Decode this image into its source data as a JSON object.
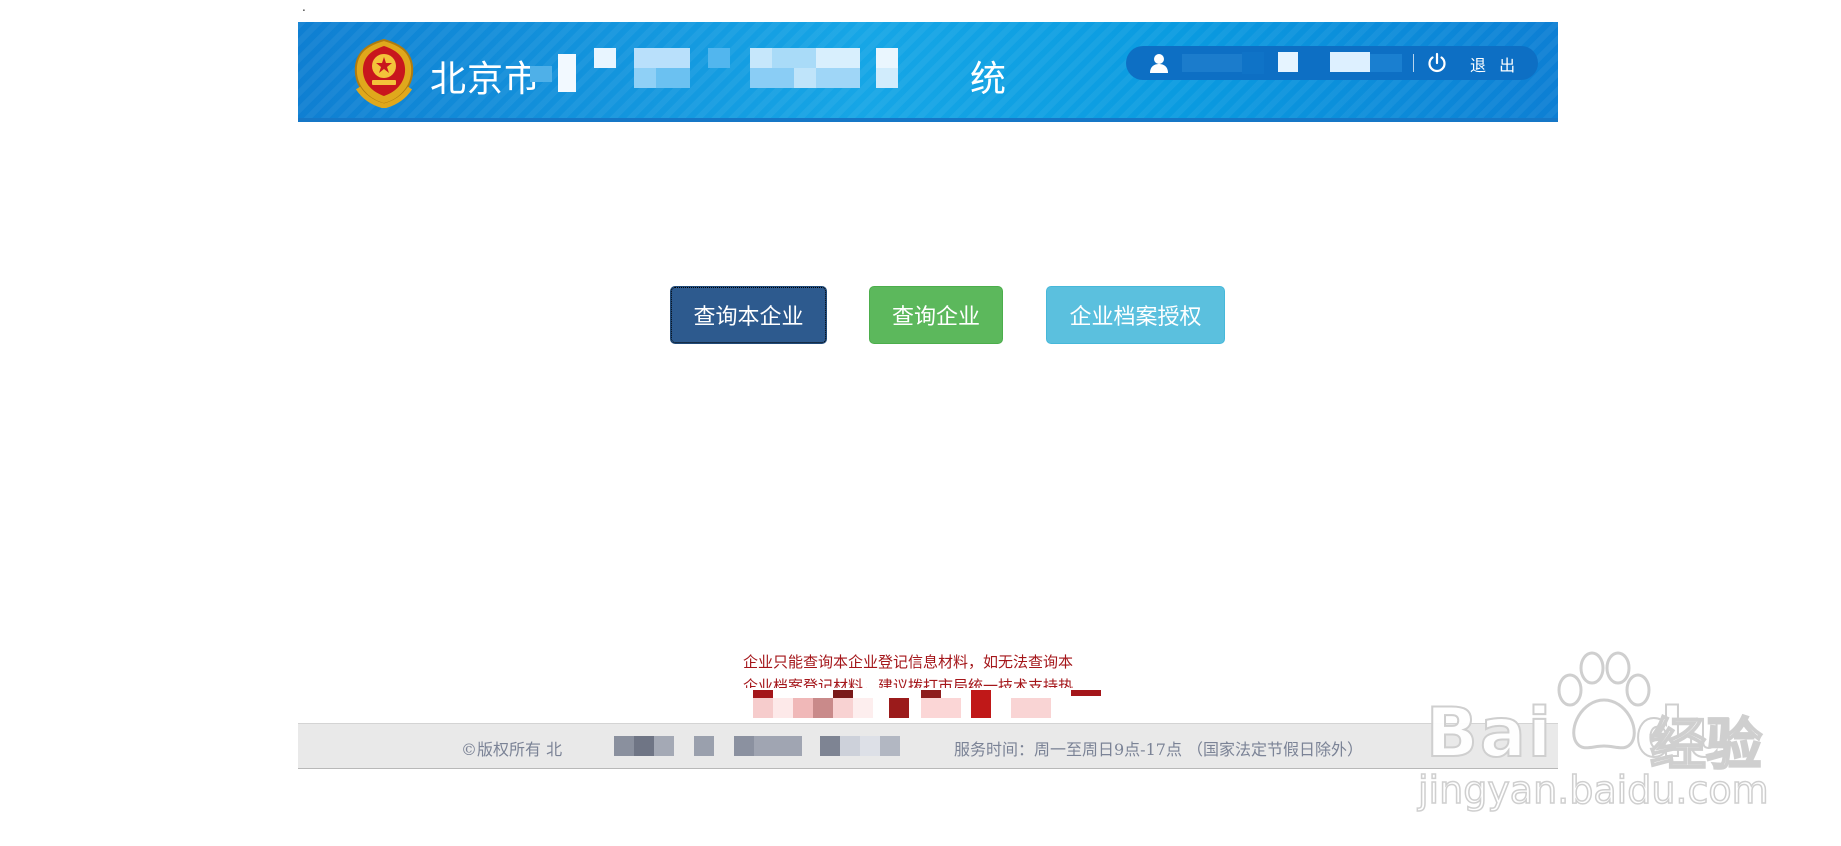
{
  "header": {
    "title_start": "北京市",
    "title_end": "统",
    "logout_label": "退 出"
  },
  "actions": {
    "query_own": "查询本企业",
    "query_enterprise": "查询企业",
    "archive_auth": "企业档案授权"
  },
  "notice": {
    "line1": "企业只能查询本企业登记信息材料，如无法查询本",
    "line2": "企业档案登记材料，建议拨打市局统一技术支持热"
  },
  "footer": {
    "copyright": "©版权所有 北",
    "service_time": "服务时间：周一至周日9点-17点 （国家法定节假日除外）"
  },
  "watermark": {
    "brand": "Bai",
    "brand_tail": "du",
    "label": "经验",
    "url": "jingyan.baidu.com"
  },
  "colors": {
    "header_blue": "#16a6e6",
    "btn_primary": "#2d5a8e",
    "btn_success": "#5cb85c",
    "btn_info": "#5bc0de",
    "notice_red": "#a4161a"
  },
  "icons": {
    "emblem": "national-emblem-icon",
    "user": "user-icon",
    "power": "power-icon"
  }
}
